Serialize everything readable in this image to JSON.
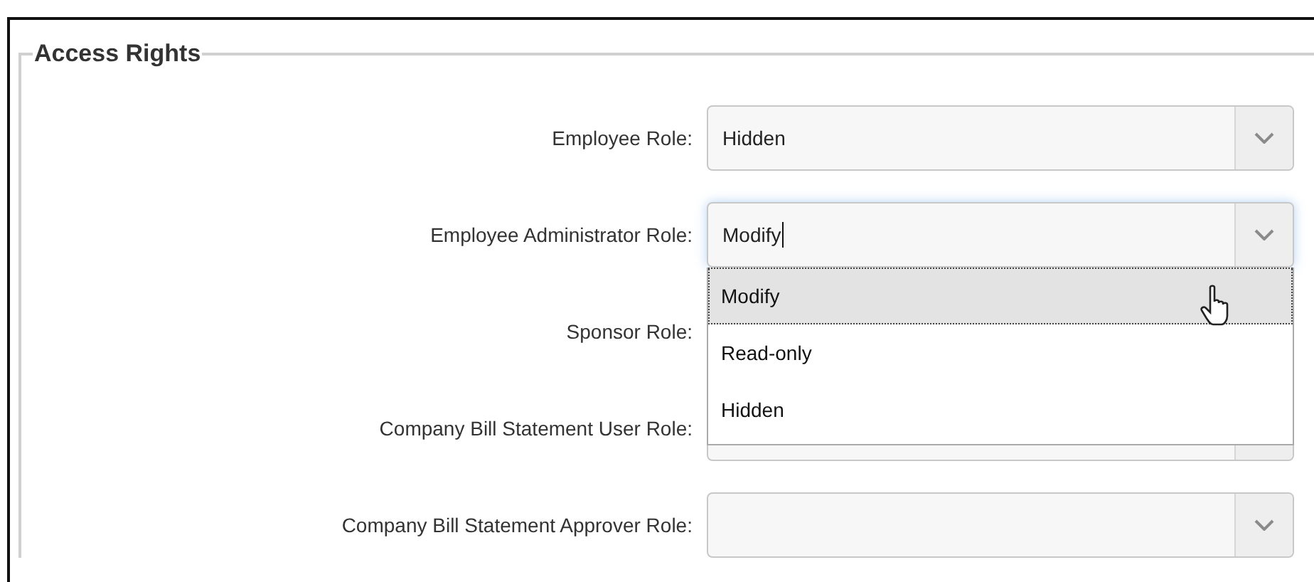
{
  "section": {
    "title": "Access Rights"
  },
  "fields": [
    {
      "label": "Employee Role:",
      "value": "Hidden",
      "focused": false
    },
    {
      "label": "Employee Administrator Role:",
      "value": "Modify",
      "focused": true,
      "dropdown": {
        "options": [
          {
            "label": "Modify",
            "selected": true
          },
          {
            "label": "Read-only",
            "selected": false
          },
          {
            "label": "Hidden",
            "selected": false
          }
        ]
      }
    },
    {
      "label": "Sponsor Role:",
      "kind": "covered"
    },
    {
      "label": "Company Bill Statement User Role:",
      "kind": "partial",
      "focused": false
    },
    {
      "label": "Company Bill Statement Approver Role:",
      "focused": false
    }
  ]
}
